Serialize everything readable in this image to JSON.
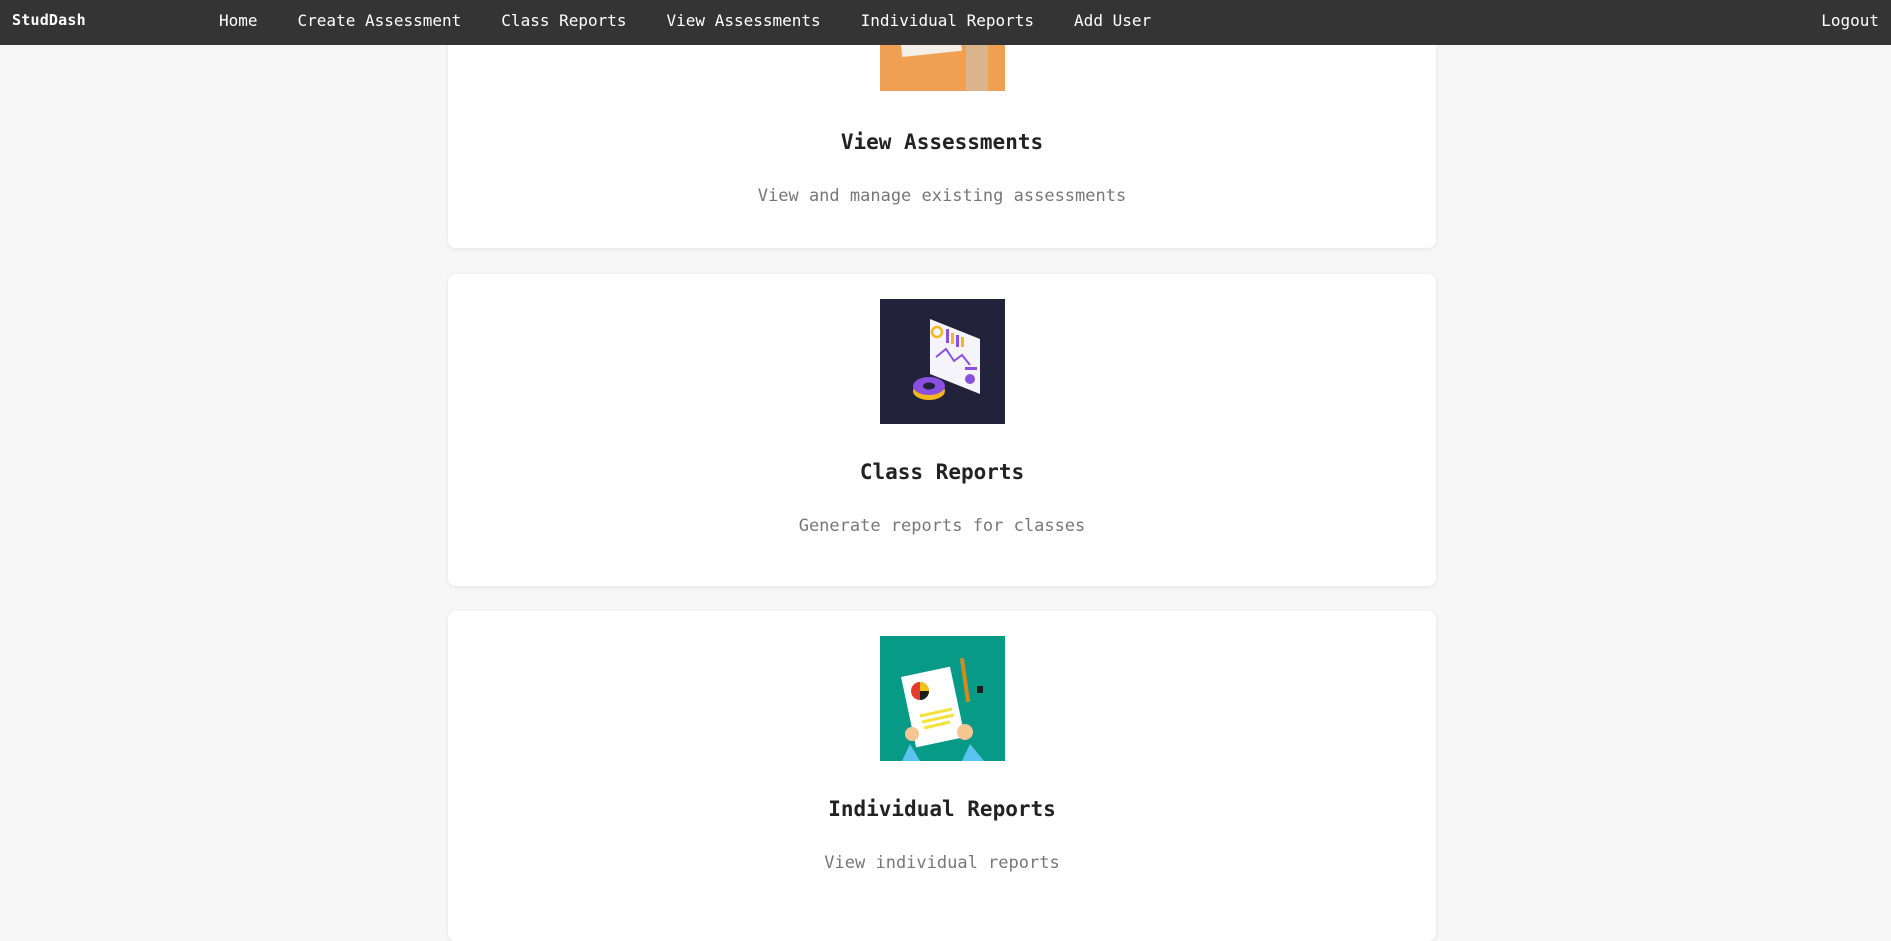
{
  "nav": {
    "brand": "StudDash",
    "links": [
      "Home",
      "Create Assessment",
      "Class Reports",
      "View Assessments",
      "Individual Reports",
      "Add User"
    ],
    "logout": "Logout"
  },
  "cards": [
    {
      "title": "View Assessments",
      "description": "View and manage existing assessments",
      "image": "assessment-illustration",
      "bg": "#f0a052"
    },
    {
      "title": "Class Reports",
      "description": "Generate reports for classes",
      "image": "dashboard-charts-illustration",
      "bg": "#22223a"
    },
    {
      "title": "Individual Reports",
      "description": "View individual reports",
      "image": "report-document-illustration",
      "bg": "#079a86"
    }
  ]
}
